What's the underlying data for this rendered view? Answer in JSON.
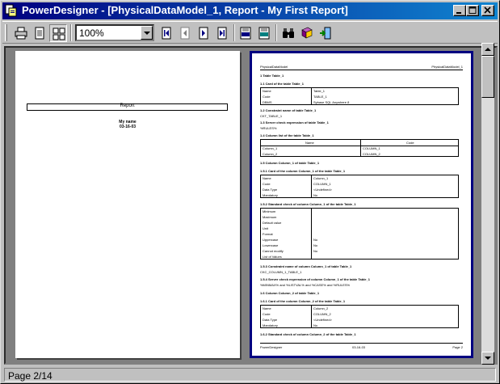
{
  "window": {
    "title": "PowerDesigner - [PhysicalDataModel_1, Report - My First Report]"
  },
  "toolbar": {
    "zoom": "100%"
  },
  "cover": {
    "report_label": "Report",
    "line1": "My name",
    "line2": "03-16-03"
  },
  "preview": {
    "header_left": "PhysicalDataModel",
    "header_right": "PhysicalDataModel_1",
    "s1": "1 Table Table_1",
    "s11": "1.1 Card of the table Table_1",
    "card1": [
      [
        "Name",
        "Table_1"
      ],
      [
        "Code",
        "TABLE_1"
      ],
      [
        "DBMS",
        "Sybase SQL Anywhere 8"
      ]
    ],
    "s12": "1.2 Constraint name of table Table_1",
    "s12v": "CKT_TABLE_1",
    "s13": "1.3 Server check expression of table Table_1",
    "s13v": "%RULES%",
    "s14": "1.4 Column list of the table Table_1",
    "col_headers": [
      "Name",
      "Code"
    ],
    "col_rows": [
      [
        "Column_1",
        "COLUMN_1"
      ],
      [
        "Column_2",
        "COLUMN_2"
      ]
    ],
    "s15": "1.5 Column Column_1 of table Table_1",
    "s151": "1.5.1 Card of the column Column_1 of the table Table_1",
    "card2": [
      [
        "Name",
        "Column_1"
      ],
      [
        "Code",
        "COLUMN_1"
      ],
      [
        "Data Type",
        "<Undefined>"
      ],
      [
        "Mandatory",
        "No"
      ]
    ],
    "s152": "1.5.2 Standard check of column Column_1 of the table Table_1",
    "std_rows": [
      [
        "Minimum",
        ""
      ],
      [
        "Maximum",
        ""
      ],
      [
        "Default value",
        ""
      ],
      [
        "Unit",
        ""
      ],
      [
        "Format",
        ""
      ],
      [
        "Uppercase",
        "No"
      ],
      [
        "Lowercase",
        "No"
      ],
      [
        "Cannot modify",
        "No"
      ],
      [
        "List of Values",
        ""
      ]
    ],
    "s153": "1.5.3 Constraint name of column Column_1 of table Table_1",
    "s153v": "CKC_COLUMN_1_TABLE_1",
    "s154": "1.5.4 Server check expression of column Column_1 of the table Table_1",
    "s154v": "%MINMAX% and %LISTVAL% and %CASE% and %RULES%",
    "s16": "1.6 Column Column_2 of table Table_1",
    "s161": "1.6.1 Card of the column Column_2 of the table Table_1",
    "card3": [
      [
        "Name",
        "Column_2"
      ],
      [
        "Code",
        "COLUMN_2"
      ],
      [
        "Data Type",
        "<Undefined>"
      ],
      [
        "Mandatory",
        "No"
      ]
    ],
    "s162": "1.6.2 Standard check of column Column_2 of the table Table_1",
    "footer_left": "PowerDesigner",
    "footer_mid": "03-16-03",
    "footer_right": "Page 2"
  },
  "status": {
    "page": "Page 2/14"
  }
}
